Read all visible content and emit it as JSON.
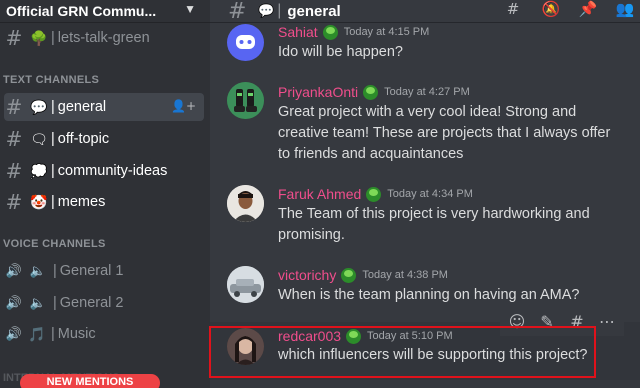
{
  "server": {
    "name": "Official GRN Commu..."
  },
  "sidebar": {
    "top_channel": {
      "emoji": "🌳",
      "label": "lets-talk-green"
    },
    "text_category": "TEXT CHANNELS",
    "text_channels": [
      {
        "emoji": "💬",
        "label": "general",
        "active": true
      },
      {
        "emoji": "🗨",
        "label": "off-topic"
      },
      {
        "emoji": "💭",
        "label": "community-ideas"
      },
      {
        "emoji": "🤡",
        "label": "memes"
      }
    ],
    "voice_category": "VOICE CHANNELS",
    "voice_channels": [
      {
        "label": "General 1"
      },
      {
        "label": "General 2"
      },
      {
        "emoji": "🎵",
        "label": "Music"
      }
    ],
    "internal_label": "INTERNAL MENTIONS",
    "new_mentions": "NEW MENTIONS"
  },
  "channel": {
    "emoji": "💬",
    "name": "general"
  },
  "messages": [
    {
      "user": "Sahiat",
      "time": "Today at 4:15 PM",
      "text": "Ido will be happen?"
    },
    {
      "user": "PriyankaOnti",
      "time": "Today at 4:27 PM",
      "text": "Great project with a very cool idea! Strong and creative team! These are projects that I always offer to friends and acquaintances"
    },
    {
      "user": "Faruk Ahmed",
      "time": "Today at 4:34 PM",
      "text": "The Team of this project is very hardworking and promising."
    },
    {
      "user": "victorichy",
      "time": "Today at 4:38 PM",
      "text": "When is the team planning on having an AMA?"
    },
    {
      "user": "redcar003",
      "time": "Today at 5:10 PM",
      "text": "which influencers will be supporting this project?"
    }
  ],
  "colors": {
    "username": "#f04e8c",
    "highlight": "#e0121b",
    "mentions": "#ed4245"
  }
}
